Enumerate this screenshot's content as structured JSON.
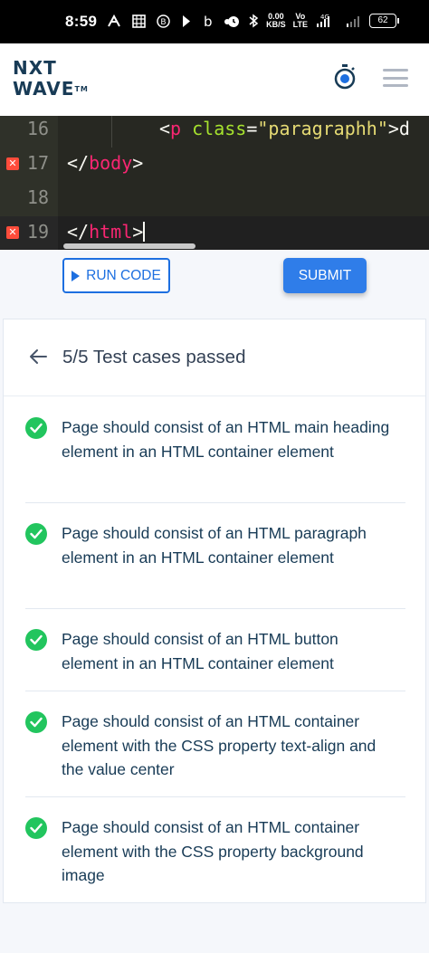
{
  "status_bar": {
    "time": "8:59",
    "net_speed_top": "0.00",
    "net_speed_bottom": "KB/S",
    "network_1": "LTE",
    "network_2": "4G",
    "battery": "62"
  },
  "header": {
    "logo_line1": "NXT",
    "logo_line2": "WAVE",
    "logo_tm": "TM"
  },
  "editor": {
    "lines": [
      {
        "number": "16",
        "error": false
      },
      {
        "number": "17",
        "error": true
      },
      {
        "number": "18",
        "error": false
      },
      {
        "number": "19",
        "error": true
      }
    ],
    "line16": {
      "open": "<",
      "tag": "p",
      "attr": " class",
      "eq": "=",
      "value": "\"paragraphh\"",
      "close": ">d"
    },
    "line17": {
      "open": "</",
      "tag": "body",
      "close": ">"
    },
    "line19": {
      "open": "</",
      "tag": "html",
      "close": ">"
    }
  },
  "actions": {
    "run_label": "RUN CODE",
    "submit_label": "SUBMIT"
  },
  "results": {
    "title": "5/5 Test cases passed",
    "cases": [
      {
        "text": "Page should consist of an HTML main heading element in an HTML container element",
        "passed": true
      },
      {
        "text": "Page should consist of an HTML paragraph element in an HTML container element",
        "passed": true
      },
      {
        "text": "Page should consist of an HTML button element in an HTML container element",
        "passed": true
      },
      {
        "text": "Page should consist of an HTML container element with the CSS property text-align and the value center",
        "passed": true
      },
      {
        "text": "Page should consist of an HTML container element with the CSS property background image",
        "passed": true
      }
    ]
  },
  "colors": {
    "brand_blue": "#1d6fe0",
    "submit_blue": "#2f7de9",
    "pass_green": "#22c55e",
    "heading_navy": "#183b56",
    "editor_bg": "#272822",
    "error_red": "#ff4c3b"
  },
  "icons": {
    "back": "arrow-left-icon",
    "check": "check-circle-icon",
    "timer": "stopwatch-icon",
    "menu": "hamburger-icon",
    "run": "play-icon"
  }
}
